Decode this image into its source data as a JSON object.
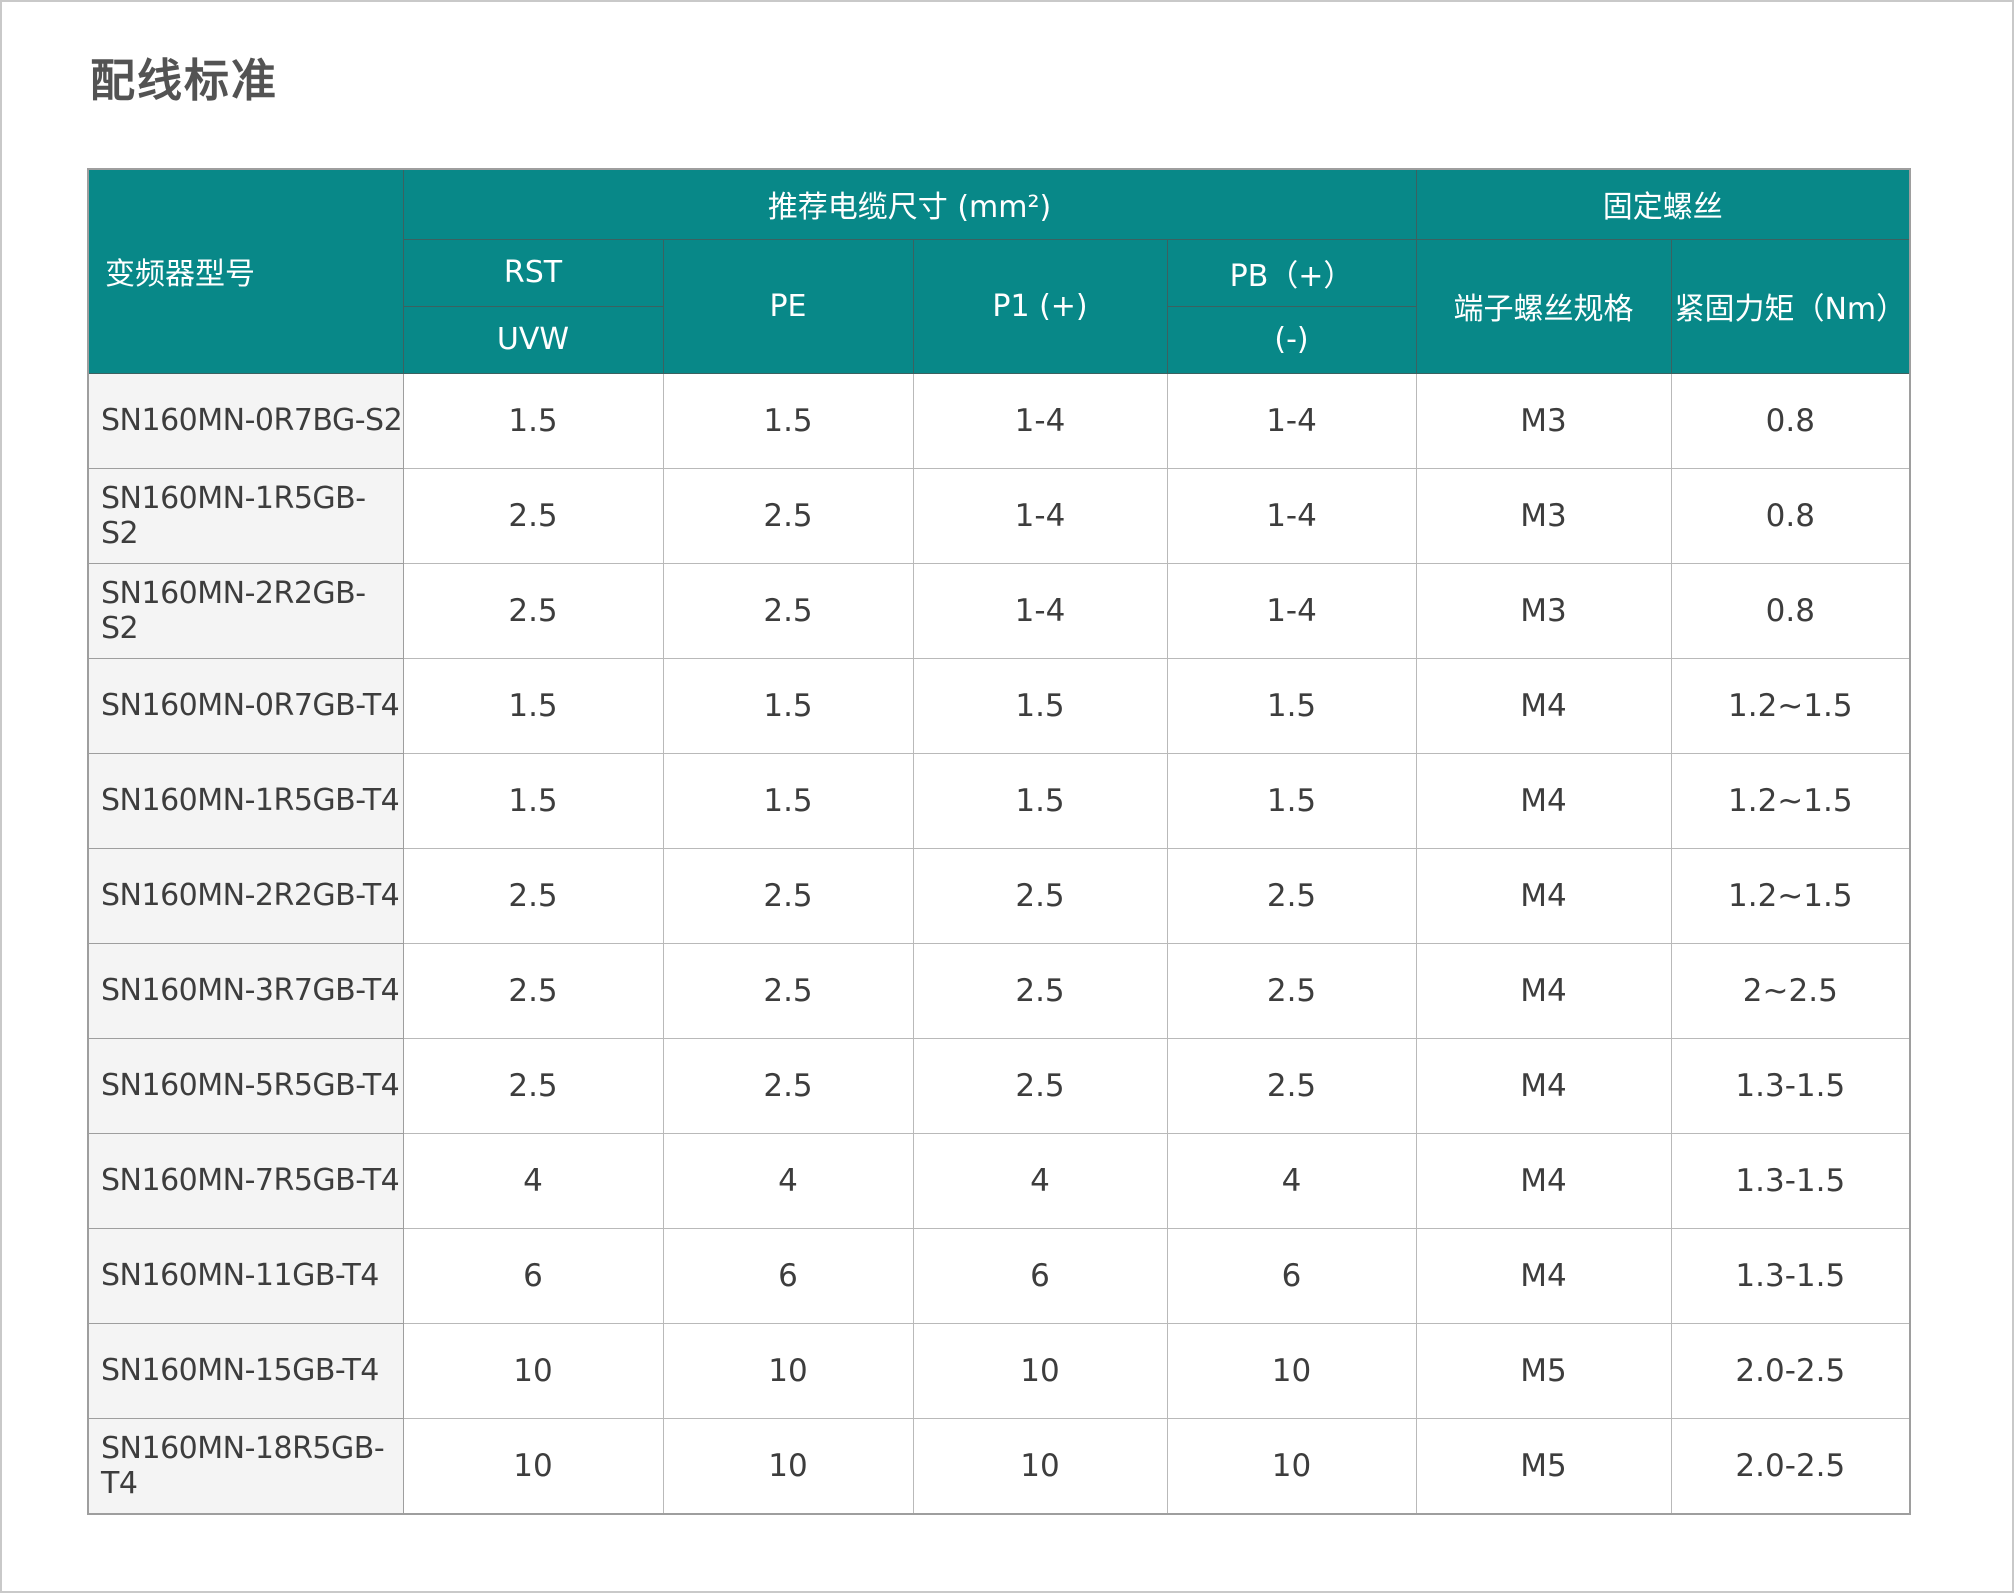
{
  "page": {
    "title": "配线标准"
  },
  "colors": {
    "header_bg": "#088888",
    "header_text": "#ffffff",
    "model_cell_bg": "#f4f4f4",
    "cell_bg": "#ffffff",
    "border_light": "#b9b9b9",
    "border_dark": "#9e9e9e",
    "header_border": "#3c6160",
    "title_text": "#535353",
    "cell_text": "#3d3d3d"
  },
  "table": {
    "header": {
      "model_col": "变频器型号",
      "group_cable": "推荐电缆尺寸 (mm²)",
      "group_screw": "固定螺丝",
      "sub": {
        "rst": "RST",
        "uvw": "UVW",
        "pe": "PE",
        "p1": "P1 (+)",
        "pb_plus": "PB（+）",
        "pb_minus": "(-)",
        "screw_spec": "端子螺丝规格",
        "torque": "紧固力矩（Nm）"
      }
    },
    "rows": [
      {
        "model": "SN160MN-0R7BG-S2",
        "rst_uvw": "1.5",
        "pe": "1.5",
        "p1": "1-4",
        "pb": "1-4",
        "screw": "M3",
        "torque": "0.8"
      },
      {
        "model": "SN160MN-1R5GB-S2",
        "rst_uvw": "2.5",
        "pe": "2.5",
        "p1": "1-4",
        "pb": "1-4",
        "screw": "M3",
        "torque": "0.8"
      },
      {
        "model": "SN160MN-2R2GB-S2",
        "rst_uvw": "2.5",
        "pe": "2.5",
        "p1": "1-4",
        "pb": "1-4",
        "screw": "M3",
        "torque": "0.8"
      },
      {
        "model": "SN160MN-0R7GB-T4",
        "rst_uvw": "1.5",
        "pe": "1.5",
        "p1": "1.5",
        "pb": "1.5",
        "screw": "M4",
        "torque": "1.2~1.5"
      },
      {
        "model": "SN160MN-1R5GB-T4",
        "rst_uvw": "1.5",
        "pe": "1.5",
        "p1": "1.5",
        "pb": "1.5",
        "screw": "M4",
        "torque": "1.2~1.5"
      },
      {
        "model": "SN160MN-2R2GB-T4",
        "rst_uvw": "2.5",
        "pe": "2.5",
        "p1": "2.5",
        "pb": "2.5",
        "screw": "M4",
        "torque": "1.2~1.5"
      },
      {
        "model": "SN160MN-3R7GB-T4",
        "rst_uvw": "2.5",
        "pe": "2.5",
        "p1": "2.5",
        "pb": "2.5",
        "screw": "M4",
        "torque": "2~2.5"
      },
      {
        "model": "SN160MN-5R5GB-T4",
        "rst_uvw": "2.5",
        "pe": "2.5",
        "p1": "2.5",
        "pb": "2.5",
        "screw": "M4",
        "torque": "1.3-1.5"
      },
      {
        "model": "SN160MN-7R5GB-T4",
        "rst_uvw": "4",
        "pe": "4",
        "p1": "4",
        "pb": "4",
        "screw": "M4",
        "torque": "1.3-1.5"
      },
      {
        "model": "SN160MN-11GB-T4",
        "rst_uvw": "6",
        "pe": "6",
        "p1": "6",
        "pb": "6",
        "screw": "M4",
        "torque": "1.3-1.5"
      },
      {
        "model": "SN160MN-15GB-T4",
        "rst_uvw": "10",
        "pe": "10",
        "p1": "10",
        "pb": "10",
        "screw": "M5",
        "torque": "2.0-2.5"
      },
      {
        "model": "SN160MN-18R5GB-T4",
        "rst_uvw": "10",
        "pe": "10",
        "p1": "10",
        "pb": "10",
        "screw": "M5",
        "torque": "2.0-2.5"
      }
    ]
  }
}
